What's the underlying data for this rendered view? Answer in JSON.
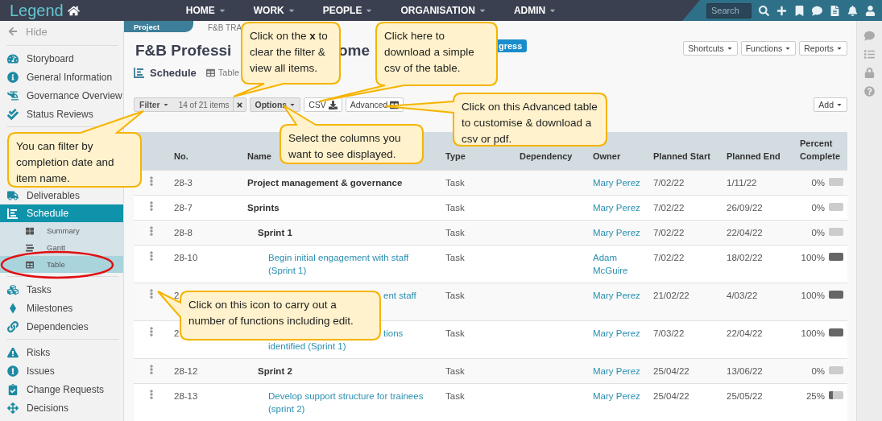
{
  "nav": {
    "logo": "Legend",
    "items": [
      {
        "label": "HOME"
      },
      {
        "label": "WORK"
      },
      {
        "label": "PEOPLE"
      },
      {
        "label": "ORGANISATION"
      },
      {
        "label": "ADMIN"
      }
    ],
    "search": {
      "placeholder": "Search"
    }
  },
  "sidebar": {
    "hide": "Hide",
    "sections": [
      {
        "items": [
          {
            "label": "Storyboard",
            "selected": false
          },
          {
            "label": "General Information",
            "selected": false
          },
          {
            "label": "Governance Overview",
            "selected": false
          },
          {
            "label": "Status Reviews",
            "selected": false
          }
        ]
      },
      {
        "items": [
          {
            "label": "Deliverables",
            "selected": false
          },
          {
            "label": "Schedule",
            "selected": true,
            "children": [
              {
                "label": "Summary",
                "selected": false
              },
              {
                "label": "Gantt",
                "selected": false
              },
              {
                "label": "Table",
                "selected": true
              }
            ]
          }
        ]
      },
      {
        "items": [
          {
            "label": "Tasks",
            "selected": false
          },
          {
            "label": "Milestones",
            "selected": false
          },
          {
            "label": "Dependencies",
            "selected": false
          }
        ]
      },
      {
        "items": [
          {
            "label": "Risks",
            "selected": false
          },
          {
            "label": "Issues",
            "selected": false
          },
          {
            "label": "Change Requests",
            "selected": false
          },
          {
            "label": "Decisions",
            "selected": false
          }
        ]
      }
    ]
  },
  "project": {
    "tab": "Project",
    "breadcrumb": "F&B TRA",
    "title_parts": [
      "F&B Professi",
      "ome"
    ],
    "status_badge": "gress",
    "actions": [
      "Shortcuts",
      "Functions",
      "Reports"
    ]
  },
  "view": {
    "section": "Schedule",
    "tab": "Table"
  },
  "toolbar": {
    "filter": "Filter",
    "filter_count": "14 of 21 items",
    "options": "Options",
    "csv": "CSV",
    "advanced": "Advanced",
    "add": "Add"
  },
  "table": {
    "columns": [
      "No.",
      "Name",
      "Type",
      "Dependency",
      "Owner",
      "Planned Start",
      "Planned End",
      "Percent Complete"
    ],
    "rows": [
      {
        "no": "28-3",
        "name": "Project management & governance",
        "kind": "group",
        "type": "Task",
        "owner": "Mary Perez",
        "start": "7/02/22",
        "end": "1/11/22",
        "percent": "0%",
        "level": 0
      },
      {
        "no": "28-7",
        "name": "Sprints",
        "kind": "group",
        "type": "Task",
        "owner": "Mary Perez",
        "start": "7/02/22",
        "end": "26/09/22",
        "percent": "0%",
        "level": 0,
        "children": [
          {
            "no": "28-8",
            "name": "Sprint 1",
            "kind": "group",
            "type": "Task",
            "owner": "Mary Perez",
            "start": "7/02/22",
            "end": "22/04/22",
            "percent": "0%",
            "level": 0,
            "children": [
              {
                "no": "28-10",
                "name": "Begin initial engagement with staff (Sprint 1)",
                "kind": "task",
                "type": "Task",
                "owner": "Adam McGuire",
                "start": "7/02/22",
                "end": "18/02/22",
                "percent": "100%",
                "level": 1
              },
              {
                "no": "2",
                "name": "ent staff",
                "kind": "partial",
                "type": "Task",
                "owner": "Mary Perez",
                "start": "21/02/22",
                "end": "4/03/22",
                "percent": "100%",
                "level": 1
              },
              {
                "no": "2",
                "name": "tions",
                "name_line2": "identified (Sprint 1)",
                "kind": "partial",
                "type": "Task",
                "owner": "Mary Perez",
                "start": "7/03/22",
                "end": "22/04/22",
                "percent": "100%",
                "level": 1
              }
            ]
          },
          {
            "no": "28-12",
            "name": "Sprint 2",
            "kind": "group",
            "type": "Task",
            "owner": "Mary Perez",
            "start": "25/04/22",
            "end": "13/06/22",
            "percent": "0%",
            "level": 0,
            "children": [
              {
                "no": "28-13",
                "name": "Develop support structure for trainees (sprint 2)",
                "kind": "task",
                "type": "Task",
                "owner": "Mary Perez",
                "start": "25/04/22",
                "end": "25/05/22",
                "percent": "25%",
                "level": 0.25
              }
            ]
          }
        ]
      }
    ]
  },
  "callouts": [
    {
      "text": "Click on the **x** to clear the filter & view all items."
    },
    {
      "text": "Click here to download a simple csv of the table."
    },
    {
      "text": "Click on this Advanced table to customise & download a csv or pdf."
    },
    {
      "text": "Select the columns you want to see displayed."
    },
    {
      "text": "You can filter by completion date and item name."
    },
    {
      "text": "Click on this icon to carry out a number of functions including edit."
    }
  ]
}
